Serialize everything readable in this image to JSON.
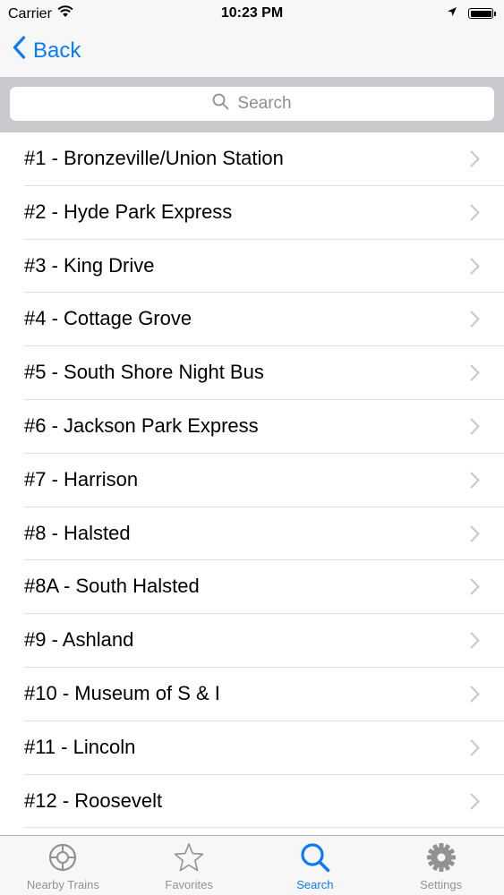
{
  "status_bar": {
    "carrier": "Carrier",
    "time": "10:23 PM"
  },
  "nav": {
    "back_label": "Back"
  },
  "search": {
    "placeholder": "Search"
  },
  "routes": [
    {
      "label": "#1 - Bronzeville/Union Station"
    },
    {
      "label": "#2 - Hyde Park Express"
    },
    {
      "label": "#3 - King Drive"
    },
    {
      "label": "#4 - Cottage Grove"
    },
    {
      "label": "#5 - South Shore Night Bus"
    },
    {
      "label": "#6 - Jackson Park Express"
    },
    {
      "label": "#7 - Harrison"
    },
    {
      "label": "#8 - Halsted"
    },
    {
      "label": "#8A - South Halsted"
    },
    {
      "label": "#9 - Ashland"
    },
    {
      "label": "#10 - Museum of S & I"
    },
    {
      "label": "#11 - Lincoln"
    },
    {
      "label": "#12 - Roosevelt"
    }
  ],
  "tab_bar": {
    "tabs": [
      {
        "label": "Nearby Trains",
        "icon": "crosshair-icon",
        "active": false
      },
      {
        "label": "Favorites",
        "icon": "star-icon",
        "active": false
      },
      {
        "label": "Search",
        "icon": "magnifier-icon",
        "active": true
      },
      {
        "label": "Settings",
        "icon": "gear-icon",
        "active": false
      }
    ]
  },
  "colors": {
    "accent": "#0a7aff",
    "inactive_tab": "#929292",
    "search_background": "#c9c9ce"
  }
}
